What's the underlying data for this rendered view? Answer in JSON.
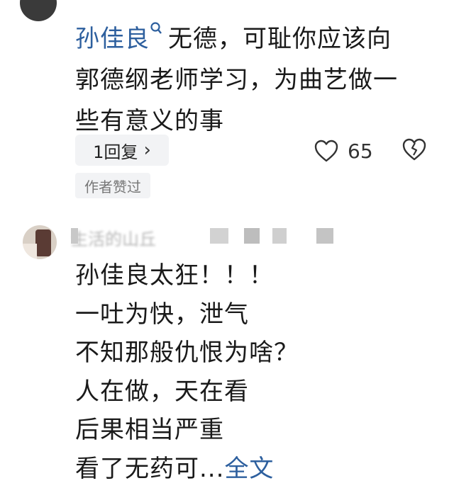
{
  "comment1": {
    "author": "孙佳良",
    "author_badge_icon": "search-badge-icon",
    "text_line1": "无德，可耻你应该向",
    "text_line2": "郭德纲老师学习，为曲艺做一",
    "text_line3": "些有意义的事",
    "reply_label": "1回复",
    "reply_chevron": "›",
    "like_count": "65",
    "author_liked_label": "作者赞过"
  },
  "comment2": {
    "username": "生活的山丘",
    "lines": [
      "孙佳良太狂！！！",
      "一吐为快，泄气",
      "不知那般仇恨为啥？",
      "人在做，天在看",
      "后果相当严重",
      "看了无药可..."
    ],
    "full_text_label": "全文"
  },
  "colors": {
    "link": "#2d5f9e",
    "text": "#1a1a1a",
    "chip_bg": "#f2f3f5"
  }
}
